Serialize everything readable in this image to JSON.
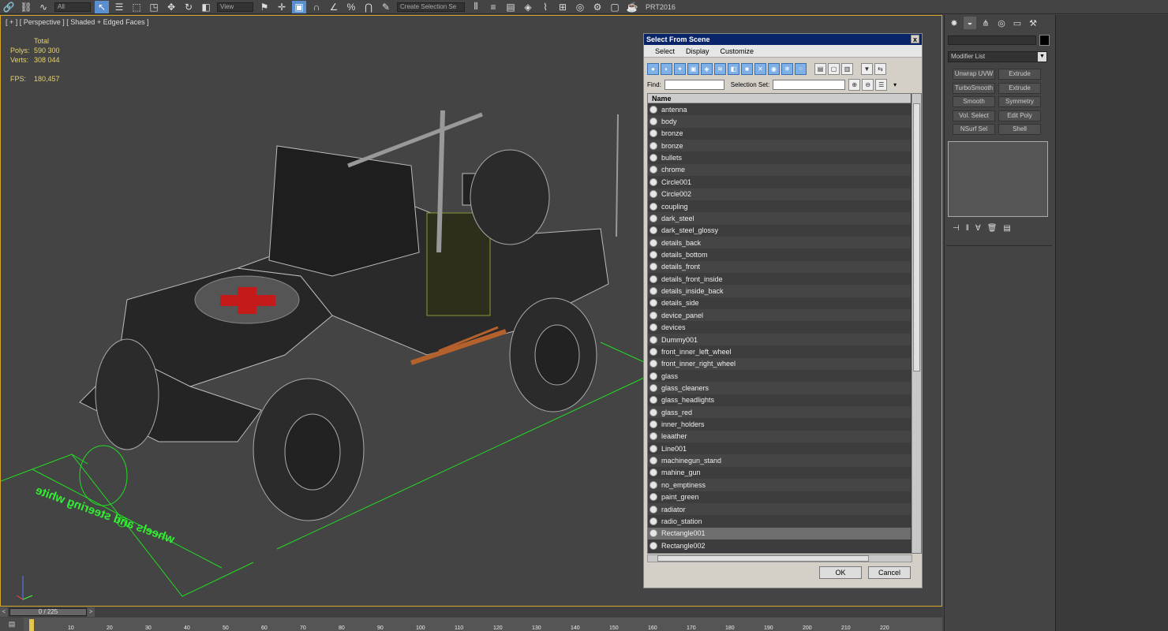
{
  "toolbar": {
    "filter_value": "All",
    "view_value": "View",
    "selection_set_value": "Create Selection Se",
    "brand": "PRT2016",
    "icons": [
      "link-icon",
      "unlink-icon",
      "bind-icon",
      "filter-dropdown",
      "select-icon",
      "select-by-name-icon",
      "rect-region-icon",
      "window-crossing-icon",
      "move-icon",
      "rotate-icon",
      "scale-icon",
      "view-dropdown",
      "pivot-icon",
      "select-manipulate-icon",
      "snap-icon",
      "angle-snap-icon",
      "percent-snap-icon",
      "spinner-snap-icon",
      "edit-named-sel-icon",
      "mirror-icon",
      "align-icon",
      "layer-icon",
      "graphite-icon",
      "curve-editor-icon",
      "schematic-icon",
      "material-editor-icon",
      "render-setup-icon",
      "render-frame-icon",
      "render-icon"
    ]
  },
  "viewport": {
    "label": "[ + ] [ Perspective ] [ Shaded + Edged Faces ]",
    "stats": {
      "total_label": "Total",
      "polys_label": "Polys:",
      "polys_value": "590 300",
      "verts_label": "Verts:",
      "verts_value": "308 044",
      "fps_label": "FPS:",
      "fps_value": "180,457"
    },
    "ground_text": "wheels and steering white"
  },
  "dialog": {
    "title": "Select From Scene",
    "close": "x",
    "menu": [
      "Select",
      "Display",
      "Customize"
    ],
    "find_label": "Find:",
    "find_value": "",
    "selection_set_label": "Selection Set:",
    "selection_set_value": "",
    "column_name": "Name",
    "items": [
      {
        "name": "antenna"
      },
      {
        "name": "body"
      },
      {
        "name": "bronze"
      },
      {
        "name": "bronze"
      },
      {
        "name": "bullets"
      },
      {
        "name": "chrome"
      },
      {
        "name": "Circle001"
      },
      {
        "name": "Circle002"
      },
      {
        "name": "coupling"
      },
      {
        "name": "dark_steel"
      },
      {
        "name": "dark_steel_glossy"
      },
      {
        "name": "details_back"
      },
      {
        "name": "details_bottom"
      },
      {
        "name": "details_front"
      },
      {
        "name": "details_front_inside"
      },
      {
        "name": "details_inside_back"
      },
      {
        "name": "details_side"
      },
      {
        "name": "device_panel"
      },
      {
        "name": "devices"
      },
      {
        "name": "Dummy001"
      },
      {
        "name": "front_inner_left_wheel"
      },
      {
        "name": "front_inner_right_wheel"
      },
      {
        "name": "glass"
      },
      {
        "name": "glass_cleaners"
      },
      {
        "name": "glass_headlights"
      },
      {
        "name": "glass_red"
      },
      {
        "name": "inner_holders"
      },
      {
        "name": "leaather"
      },
      {
        "name": "Line001"
      },
      {
        "name": "machinegun_stand"
      },
      {
        "name": "mahine_gun"
      },
      {
        "name": "no_emptiness"
      },
      {
        "name": "paint_green"
      },
      {
        "name": "radiator"
      },
      {
        "name": "radio_station"
      },
      {
        "name": "Rectangle001",
        "selected": true
      },
      {
        "name": "Rectangle002"
      }
    ],
    "ok": "OK",
    "cancel": "Cancel"
  },
  "command_panel": {
    "modifier_list": "Modifier List",
    "buttons": [
      "Unwrap UVW",
      "Extrude",
      "TurboSmooth",
      "Extrude",
      "Smooth",
      "Symmetry",
      "Vol. Select",
      "Edit Poly",
      "NSurf Sel",
      "Shell"
    ]
  },
  "timeline": {
    "slider": "0 / 225",
    "ticks": [
      "10",
      "20",
      "30",
      "40",
      "50",
      "60",
      "70",
      "80",
      "90",
      "100",
      "110",
      "120",
      "130",
      "140",
      "150",
      "160",
      "170",
      "180",
      "190",
      "200",
      "210",
      "220"
    ]
  }
}
